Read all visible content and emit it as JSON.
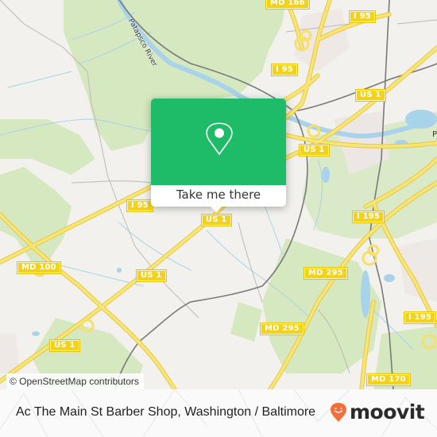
{
  "map": {
    "attribution": "© OpenStreetMap contributors",
    "river_label": "Patapsco River",
    "edge_label": "P",
    "colors": {
      "background": "#f2f1ed",
      "park": "#d6e8bf",
      "water": "#a9d3ea",
      "motorway": "#f5e06a",
      "shield": "#f2d21c",
      "rail": "#777777"
    },
    "shields": [
      {
        "id": "md166-top",
        "label": "MD 166"
      },
      {
        "id": "i95-top-right",
        "label": "I 95"
      },
      {
        "id": "i95-mid",
        "label": "I 95"
      },
      {
        "id": "us1-right",
        "label": "US 1"
      },
      {
        "id": "us1-near-popup",
        "label": "US 1"
      },
      {
        "id": "i95-left",
        "label": "I 95"
      },
      {
        "id": "us1-center",
        "label": "US 1"
      },
      {
        "id": "md100",
        "label": "MD 100"
      },
      {
        "id": "us1-center-lower",
        "label": "US 1"
      },
      {
        "id": "i195-upper",
        "label": "I 195"
      },
      {
        "id": "md295-upper",
        "label": "MD 295"
      },
      {
        "id": "us1-lower-left",
        "label": "US 1"
      },
      {
        "id": "md295-lower",
        "label": "MD 295"
      },
      {
        "id": "i195-lower",
        "label": "I 195"
      },
      {
        "id": "md170",
        "label": "MD 170"
      }
    ]
  },
  "popup": {
    "icon": "map-pin-icon",
    "button_label": "Take me there",
    "color": "#1ebb68"
  },
  "footer": {
    "title": "Ac The Main St Barber Shop, Washington / Baltimore",
    "brand": "moovit",
    "brand_icon": "moovit-smiley-pin-icon",
    "brand_color": "#f26f3a"
  }
}
